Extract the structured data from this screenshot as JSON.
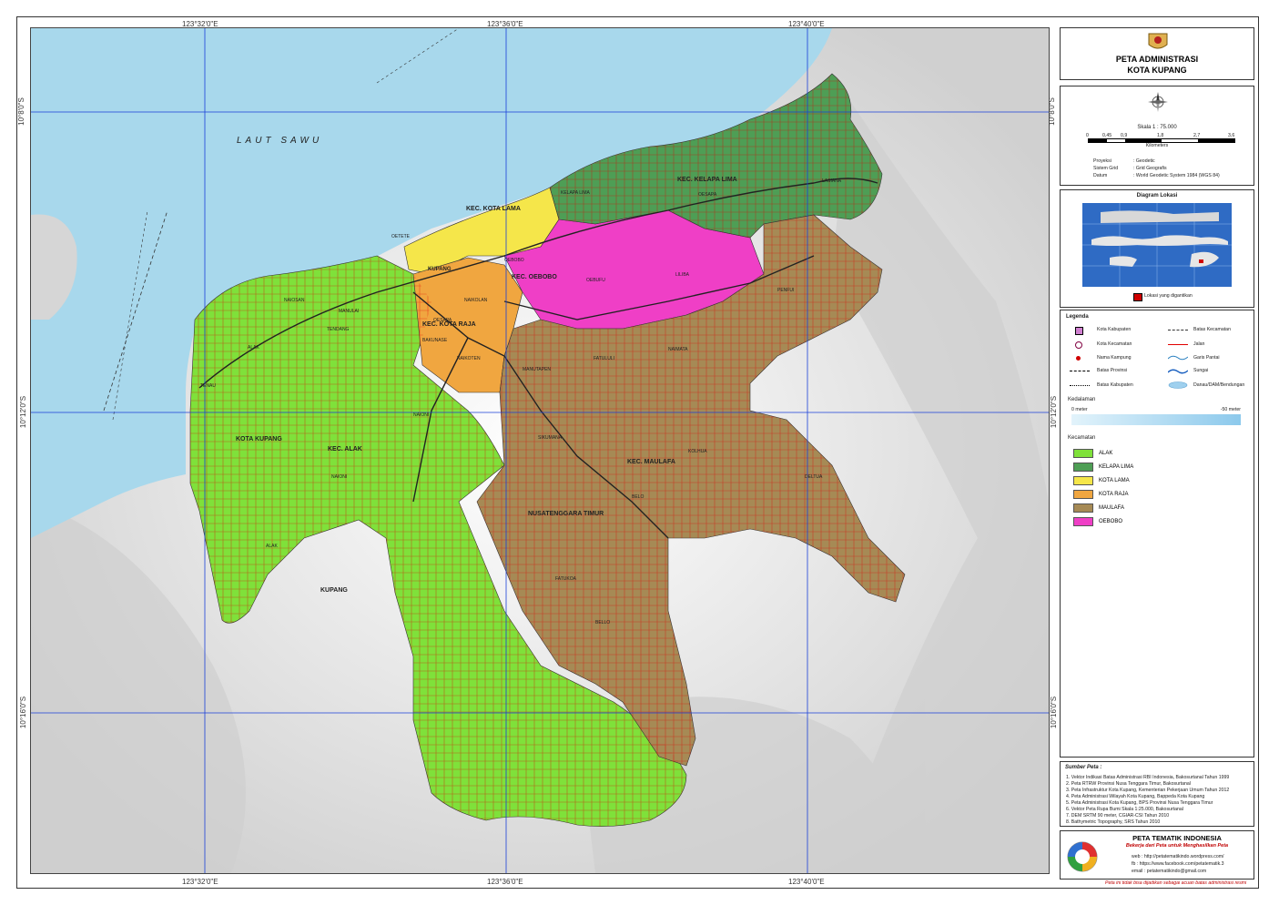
{
  "map": {
    "sea_label": "LAUT SAWU",
    "top_coords": [
      "123°32'0\"E",
      "123°36'0\"E",
      "123°40'0\"E"
    ],
    "bottom_coords": [
      "123°32'0\"E",
      "123°36'0\"E",
      "123°40'0\"E"
    ],
    "left_coords": [
      "10°8'0\"S",
      "10°12'0\"S",
      "10°16'0\"S"
    ],
    "right_coords": [
      "10°8'0\"S",
      "10°12'0\"S",
      "10°16'0\"S"
    ],
    "district_labels": [
      "KEC. KELAPA LIMA",
      "KEC. KOTA LAMA",
      "KEC. OEBOBO",
      "KEC. KOTA RAJA",
      "KEC. ALAK",
      "KEC. MAULAFA",
      "KOTA KUPANG",
      "NUSATENGGARA TIMUR",
      "KUPANG"
    ],
    "place_labels": [
      "KELAPA LIMA",
      "OESAPA",
      "LASIANA",
      "OEBOBO",
      "LILIBA",
      "PENFUI",
      "NAIMATA",
      "FATULULI",
      "OEBUFU",
      "KUPANG",
      "NAIOSAN",
      "TENDANG",
      "ALAK",
      "MANULAI",
      "OESAPA",
      "NAIKOLAN",
      "SIKUMANA",
      "KOLHUA",
      "DELTUA",
      "BELO",
      "FATUKOA",
      "NAIONI",
      "ALAK",
      "MANUTAPEN",
      "TENAU",
      "NAIONI",
      "OETETE",
      "BELLO",
      "NAIKOTEN",
      "BAKUNASE"
    ],
    "colors": {
      "sea": "#a8d8ec",
      "alak": "#7fe13a",
      "kelapa_lima": "#4e9e55",
      "kota_lama": "#f5e64a",
      "kota_raja": "#f0a640",
      "maulafa": "#a68a55",
      "oebobo": "#ef3fc6",
      "roads": "#e00000",
      "grid": "#1a3fd8"
    }
  },
  "title_panel": {
    "line1": "PETA ADMINISTRASI",
    "line2": "KOTA KUPANG"
  },
  "info_panel": {
    "scale": "Skala 1 : 75.000",
    "scale_ticks": [
      "0",
      "0,45",
      "0,9",
      "1,8",
      "2,7",
      "3,6"
    ],
    "scale_unit": "Kilometers",
    "rows": [
      {
        "label": "Proyeksi",
        "value": ": Geodetic"
      },
      {
        "label": "Sistem Grid",
        "value": ": Grid Geografis"
      },
      {
        "label": "Datum",
        "value": ": World Geodetic System 1984 (WGS 84)"
      }
    ]
  },
  "location_panel": {
    "title": "Diagram Lokasi",
    "legend": "Lokasi yang digantikan"
  },
  "legend_panel": {
    "title": "Legenda",
    "items_left": [
      "Kota Kabupaten",
      "Kota Kecamatan",
      "Nama Kampung",
      "Batas Provinsi",
      "Batas Kabupaten"
    ],
    "items_right": [
      "Batas Kecamatan",
      "Jalan",
      "Garis Pantai",
      "Sungai",
      "Danau/DAM/Bendungan"
    ],
    "depth_title": "Kedalaman",
    "depth_min": "0 meter",
    "depth_max": "-50 meter",
    "kecamatan_title": "Kecamatan",
    "kecamatan": [
      {
        "name": "ALAK",
        "color": "#7fe13a"
      },
      {
        "name": "KELAPA LIMA",
        "color": "#4e9e55"
      },
      {
        "name": "KOTA LAMA",
        "color": "#f5e64a"
      },
      {
        "name": "KOTA RAJA",
        "color": "#f0a640"
      },
      {
        "name": "MAULAFA",
        "color": "#a68a55"
      },
      {
        "name": "OEBOBO",
        "color": "#ef3fc6"
      }
    ]
  },
  "source_panel": {
    "title": "Sumber Peta :",
    "lines": [
      "1. Vektor Indikasi Batas Administrasi RBI Indonesia, Bakosurtanal Tahun 1999",
      "2. Peta RTRW Provinsi Nusa Tenggara Timur, Bakosurtanal",
      "3. Peta Infrastruktur Kota Kupang, Kementerian Pekerjaan Umum Tahun 2012",
      "4. Peta Administrasi Wilayah Kota Kupang, Bappeda Kota Kupang",
      "5. Peta Administrasi Kota Kupang, BPS Provinsi Nusa Tenggara Timur",
      "6. Vektor Peta Rupa Bumi Skala 1:25.000, Bakosurtanal",
      "7. DEM SRTM 90 meter, CGIAR-CSI Tahun 2010",
      "8. Bathymetric Topography, SRS Tahun 2010"
    ]
  },
  "brand_panel": {
    "name": "PETA TEMATIK INDONESIA",
    "tagline": "Bekerja dari Peta untuk Menghasilkan Peta",
    "web": "web : http://petatematikindo.wordpress.com/",
    "fb": "fb : https://www.facebook.com/petatematik.3",
    "email": "email : petatematikindo@gmail.com",
    "note": "Peta ini tidak bisa dijadikan sebagai acuan batas administrasi resmi"
  }
}
